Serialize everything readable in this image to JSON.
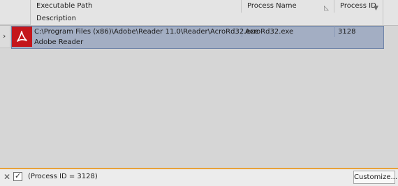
{
  "columns": {
    "executable_path": "Executable Path",
    "process_name": "Process Name",
    "process_id": "Process ID",
    "description": "Description"
  },
  "sort_icons": {
    "process_name": "sort-indicator-icon",
    "process_id": "filter-funnel-icon"
  },
  "rows": [
    {
      "executable_path": "C:\\Program Files (x86)\\Adobe\\Reader 11.0\\Reader\\AcroRd32.exe",
      "process_name": "AcroRd32.exe",
      "process_id": "3128",
      "description": "Adobe Reader",
      "icon": "adobe-reader-icon",
      "selected": true
    }
  ],
  "footer": {
    "filter_text": "(Process ID = 3128)",
    "filter_enabled": true,
    "customize_label": "Customize..."
  },
  "colors": {
    "selection": "#a3aec3",
    "selection_border": "#6f84a8",
    "footer_accent": "#e8a23a",
    "icon_red": "#c4161c"
  }
}
